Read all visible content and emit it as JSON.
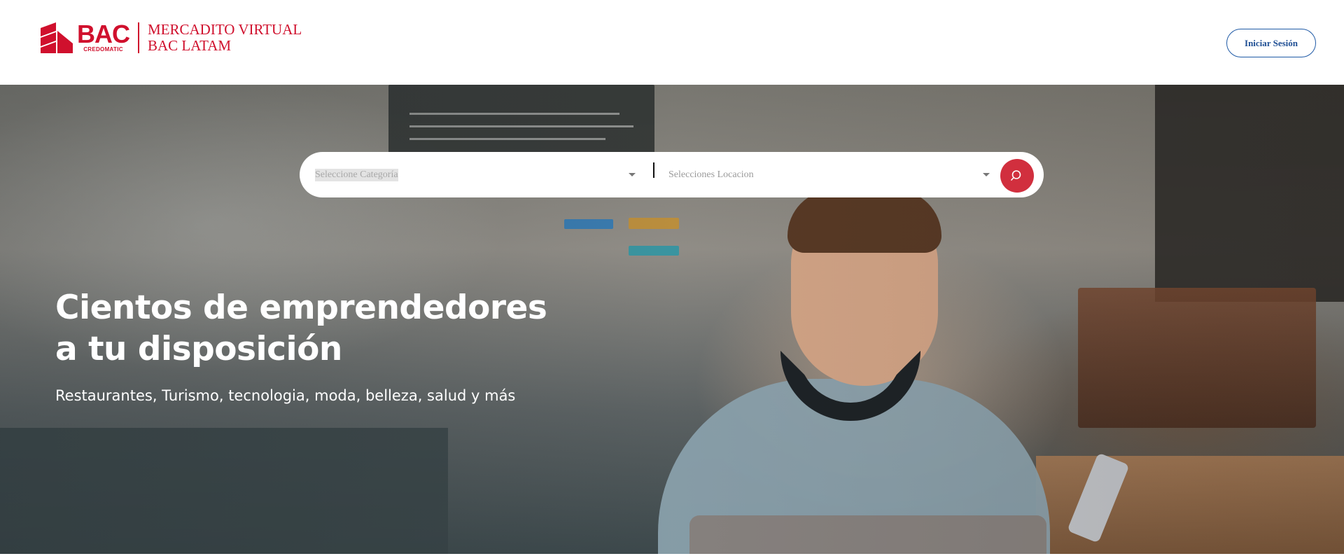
{
  "header": {
    "logo": {
      "brand": "BAC",
      "brand_sub": "CREDOMATIC",
      "title_line1": "MERCADITO VIRTUAL",
      "title_line2": "BAC LATAM"
    },
    "login_label": "Iniciar Sesión"
  },
  "search": {
    "category_placeholder": "Seleccione Categoría",
    "location_placeholder": "Selecciones Locacion",
    "search_icon": "search-icon"
  },
  "hero": {
    "title_line1": "Cientos de emprendedores",
    "title_line2": "a tu disposición",
    "subtitle": "Restaurantes, Turismo, tecnologia, moda, belleza, salud y más"
  },
  "colors": {
    "brand_red": "#d0102d",
    "search_button": "#d12f3e",
    "login_border": "#1f5aa6"
  }
}
